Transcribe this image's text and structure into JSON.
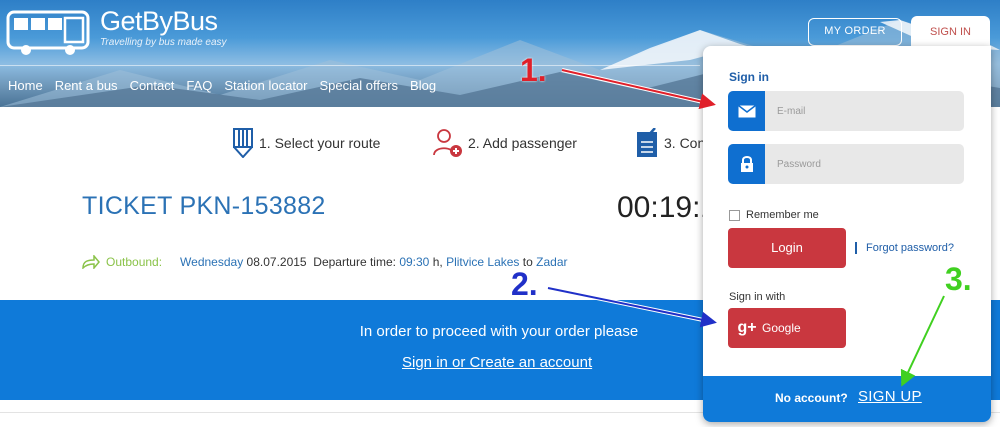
{
  "logo": {
    "name": "GetByBus",
    "tagline": "Travelling by bus made easy"
  },
  "nav": [
    "Home",
    "Rent a bus",
    "Contact",
    "FAQ",
    "Station locator",
    "Special offers",
    "Blog"
  ],
  "header_buttons": {
    "my_order": "MY ORDER",
    "sign_in": "SIGN IN"
  },
  "steps": [
    {
      "label": "1. Select your route",
      "icon": "pencils-icon"
    },
    {
      "label": "2. Add passenger",
      "icon": "add-person-icon"
    },
    {
      "label": "3. Con",
      "icon": "checklist-icon"
    }
  ],
  "ticket": {
    "title": "TICKET PKN-153882",
    "timer": "00:19:1",
    "outbound": {
      "label": "Outbound:",
      "weekday": "Wednesday",
      "date": "08.07.2015",
      "dep_label": "Departure time:",
      "time": "09:30",
      "time_unit": "h,",
      "from": "Plitvice Lakes",
      "to_word": "to",
      "to": "Zadar"
    }
  },
  "band": {
    "message": "In order to proceed with your order please",
    "link": "Sign in or Create an account"
  },
  "signin_panel": {
    "heading": "Sign in",
    "email_placeholder": "E-mail",
    "password_placeholder": "Password",
    "remember": "Remember me",
    "login": "Login",
    "forgot": "Forgot password?",
    "sign_in_with": "Sign in with",
    "google": "Google",
    "no_account": "No account?",
    "sign_up": "SIGN UP"
  },
  "annotations": {
    "n1": "1.",
    "n2": "2.",
    "n3": "3."
  },
  "colors": {
    "primary_blue": "#0f7ad9",
    "red_button": "#c9373f",
    "annotation_red": "#e0202a",
    "annotation_blue": "#2030c8",
    "annotation_green": "#40d020"
  }
}
